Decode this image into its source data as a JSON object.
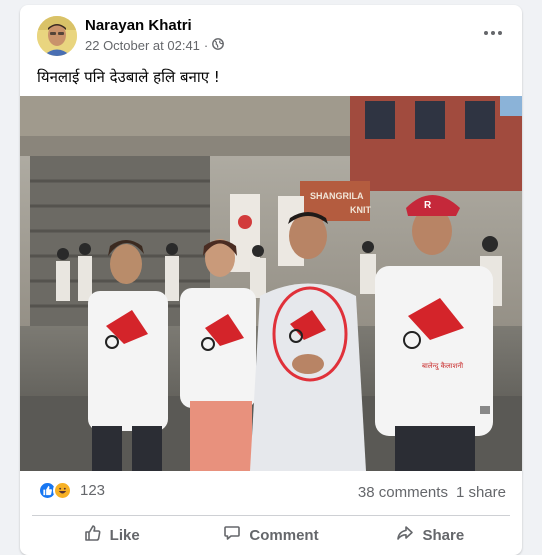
{
  "post": {
    "author": "Narayan Khatri",
    "timestamp": "22 October at 02:41",
    "separator": "·",
    "privacy_icon": "globe-icon",
    "more_icon": "ellipsis-icon",
    "text": "यिनलाई पनि देउबाले हलि बनाए !"
  },
  "photo": {
    "signs": [
      "SHANGRILA",
      "KNIT"
    ],
    "shirt_text": "बालेन्दु कैलाशनी"
  },
  "engagement": {
    "reaction_icons": [
      "like-icon",
      "haha-icon"
    ],
    "reaction_count": "123",
    "comments": "38 comments",
    "shares": "1 share"
  },
  "actions": {
    "like": "Like",
    "comment": "Comment",
    "share": "Share"
  },
  "colors": {
    "facebook_blue": "#1877f2",
    "haha_yellow": "#f7b125",
    "secondary_text": "#65676b",
    "circle_annotation": "#e0313a"
  }
}
